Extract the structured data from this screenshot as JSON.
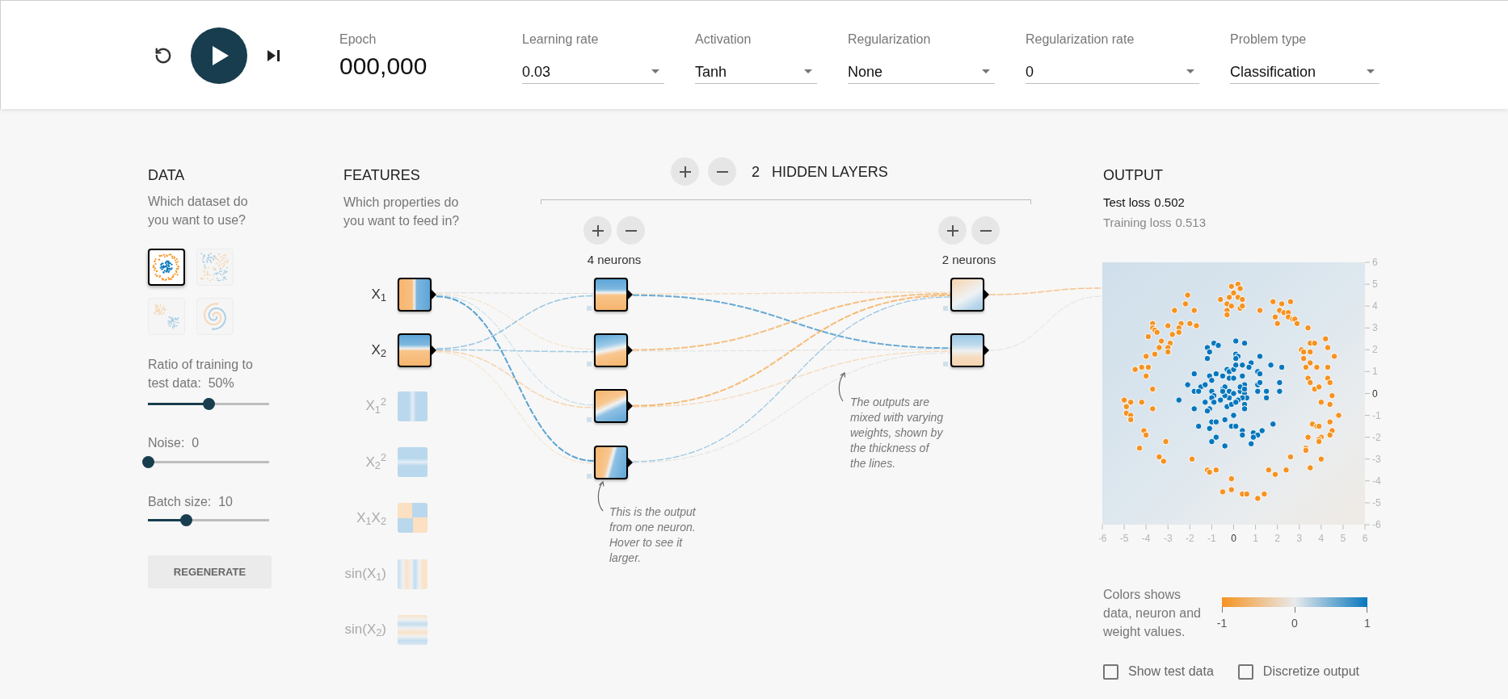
{
  "toolbar": {
    "playing": false,
    "epoch_label": "Epoch",
    "epoch": "000,000",
    "dropdowns": [
      {
        "label": "Learning rate",
        "value": "0.03"
      },
      {
        "label": "Activation",
        "value": "Tanh"
      },
      {
        "label": "Regularization",
        "value": "None"
      },
      {
        "label": "Regularization rate",
        "value": "0"
      },
      {
        "label": "Problem type",
        "value": "Classification"
      }
    ]
  },
  "data": {
    "title": "DATA",
    "prompt": "Which dataset do you want to use?",
    "datasets": [
      {
        "kind": "circle",
        "selected": true
      },
      {
        "kind": "xor",
        "selected": false
      },
      {
        "kind": "gauss",
        "selected": false
      },
      {
        "kind": "spiral",
        "selected": false
      }
    ],
    "sliders": [
      {
        "label": "Ratio of training to test data:",
        "reading": "50%",
        "level": 0.5
      },
      {
        "label": "Noise:",
        "reading": "0",
        "level": 0
      },
      {
        "label": "Batch size:",
        "reading": "10",
        "level": 0.31
      }
    ],
    "button": "REGENERATE"
  },
  "features": {
    "title": "FEATURES",
    "prompt": "Which properties do you want to feed in?",
    "items": [
      {
        "label": "X$_{1}$",
        "kind": "vertical",
        "selected": true
      },
      {
        "label": "X$_{2}$",
        "kind": "horizontal",
        "selected": true
      },
      {
        "label": "X$_{1}$$^{2}$",
        "kind": "vband",
        "selected": false
      },
      {
        "label": "X$_{2}$$^{2}$",
        "kind": "hband",
        "selected": false
      },
      {
        "label": "X$_{1}$X$_{2}$",
        "kind": "quadrants",
        "selected": false
      },
      {
        "label": "sin(X$_{1}$)",
        "kind": "vstripes",
        "selected": false
      },
      {
        "label": "sin(X$_{2}$)",
        "kind": "hstripes",
        "selected": false
      }
    ]
  },
  "network": {
    "layer_count": "2",
    "layers_label": "HIDDEN LAYERS",
    "layers": [
      {
        "neurons_label": "4 neurons",
        "nodes": [
          {
            "kind": "horizontal"
          },
          {
            "kind": "tilted"
          },
          {
            "kind": "diagonal"
          },
          {
            "kind": "slanted"
          }
        ]
      },
      {
        "neurons_label": "2 neurons",
        "nodes": [
          {
            "kind": "faded"
          },
          {
            "kind": "soft"
          }
        ]
      }
    ],
    "notes": [
      "This is the output from one neuron. Hover to see it larger.",
      "The outputs are mixed with varying weights, shown by the thickness of the lines."
    ]
  },
  "output": {
    "title": "OUTPUT",
    "test_loss": {
      "label": "Test loss",
      "value": "0.502"
    },
    "training_loss": {
      "label": "Training loss",
      "value": "0.513"
    },
    "chart_data": {
      "type": "scatter",
      "xlim": [
        -6,
        6
      ],
      "ylim": [
        -6,
        6
      ],
      "xticks": [
        -6,
        -5,
        -4,
        -3,
        -2,
        -1,
        0,
        1,
        2,
        3,
        4,
        5,
        6
      ],
      "yticks": [
        6,
        5,
        4,
        3,
        2,
        1,
        0,
        -1,
        -2,
        -3,
        -4,
        -5,
        -6
      ],
      "series": [
        {
          "color": "#f59322",
          "x": [
            -0.1,
            0.2,
            0.3,
            -0.6,
            -0.2,
            0.0,
            0.2,
            0.4,
            -0.3,
            -0.1,
            0.3,
            0.4,
            -0.3,
            -0.3,
            1.2,
            1.8,
            2.2,
            2.6,
            1.9,
            2.1,
            2.3,
            2.5,
            2.5,
            2.7,
            2.8,
            2.9,
            2.0,
            3.4,
            -2.1,
            -2.2,
            -2.7,
            -1.8,
            -2.4,
            -2.0,
            -1.7,
            -2.5,
            -2.5,
            -3.0,
            -2.8,
            -3.3,
            -2.9,
            -3.0,
            -3.0,
            -3.4,
            -3.7,
            -3.7,
            -3.6,
            -3.5,
            -3.9,
            -3.6,
            -4.0,
            -3.9,
            -4.2,
            -4.0,
            -4.5,
            -3.7,
            -5.0,
            -4.7,
            -4.9,
            -4.9,
            -4.7,
            -4.7,
            -4.2,
            -3.7,
            -4.1,
            -4.0,
            -4.3,
            -3.1,
            -3.4,
            -3.2,
            -1.9,
            -1.2,
            -1.1,
            -0.8,
            -0.1,
            -0.1,
            -0.5,
            0.4,
            0.6,
            1.1,
            1.4,
            1.6,
            1.9,
            2.4,
            2.6,
            3.5,
            4.0,
            3.5,
            3.7,
            4.2,
            4.3,
            4.6,
            3.1,
            3.2,
            3.5,
            3.2,
            3.5,
            3.3,
            3.8,
            4.3,
            3.4,
            3.5,
            3.7,
            3.9,
            4.3,
            4.4,
            4.5,
            4.0,
            4.4,
            4.8,
            3.6,
            3.8,
            3.9,
            4.4,
            4.5,
            4.4,
            4.0,
            3.9,
            3.9,
            3.4,
            3.3,
            3.3
          ],
          "values": [
            4.9,
            5.0,
            4.8,
            4.3,
            4.4,
            4.6,
            4.4,
            4.3,
            4.1,
            4.0,
            3.9,
            4.0,
            3.8,
            3.6,
            3.8,
            4.2,
            4.1,
            4.2,
            3.5,
            3.8,
            3.7,
            3.7,
            3.5,
            3.4,
            3.4,
            3.2,
            3.2,
            3.0,
            4.5,
            4.1,
            3.8,
            3.8,
            3.2,
            3.2,
            3.1,
            3.0,
            2.8,
            3.1,
            2.7,
            2.4,
            2.3,
            2.1,
            1.9,
            2.1,
            3.2,
            3.0,
            2.9,
            2.8,
            2.6,
            1.8,
            1.7,
            1.2,
            1.2,
            0.8,
            1.1,
            0.2,
            -0.3,
            -0.4,
            -0.6,
            -0.9,
            -1.0,
            -1.2,
            -0.4,
            -0.7,
            -1.7,
            -1.9,
            -2.5,
            -2.2,
            -2.9,
            -3.1,
            -3.0,
            -3.5,
            -3.6,
            -3.5,
            -3.9,
            -4.4,
            -4.5,
            -4.6,
            -4.6,
            -4.8,
            -4.6,
            -3.5,
            -3.7,
            -3.5,
            -2.9,
            -3.4,
            -3.0,
            2.3,
            2.3,
            2.5,
            2.1,
            1.7,
            2.0,
            1.9,
            1.9,
            1.6,
            1.4,
            1.2,
            1.2,
            1.2,
            0.7,
            0.5,
            0.2,
            0.3,
            0.7,
            0.5,
            -0.1,
            -0.4,
            -0.5,
            -1.0,
            -1.4,
            -1.5,
            -1.5,
            -1.3,
            -1.7,
            -1.9,
            -2.0,
            -2.1,
            -2.2,
            -2.0,
            -2.5,
            -2.6
          ]
        },
        {
          "color": "#0877bd",
          "x": [
            0.1,
            0.5,
            -0.9,
            -0.7,
            -1.2,
            -1.1,
            -1.2,
            0.1,
            0.2,
            0.1,
            1.2,
            0.8,
            0.4,
            0.7,
            1.7,
            2.2,
            -1.8,
            -1.1,
            -0.8,
            -0.5,
            -0.3,
            -0.2,
            0.0,
            -0.2,
            0.0,
            0.4,
            1.1,
            1.2,
            -1.0,
            -2.1,
            -1.5,
            -1.3,
            -1.8,
            -1.6,
            -1.0,
            -0.9,
            -1.0,
            -0.5,
            -0.4,
            -0.2,
            0.0,
            0.3,
            0.5,
            0.3,
            1.1,
            1.2,
            1.5,
            2.1,
            2.1,
            1.1,
            0.5,
            0.6,
            0.4,
            0.2,
            -0.2,
            -0.4,
            -0.6,
            -0.9,
            -1.3,
            -2.5,
            -1.8,
            -1.1,
            -1.2,
            -0.3,
            -0.1,
            0.1,
            0.5,
            0.5,
            0.0,
            -0.4,
            -1.0,
            -0.8,
            -1.6,
            -1.1,
            -0.1,
            0.1,
            0.4,
            0.4,
            0.9,
            1.1,
            1.3,
            1.8,
            0.9,
            0.8,
            -0.8,
            -1.0,
            -0.4,
            1.5,
            0.1,
            -0.5,
            0.5
          ],
          "values": [
            2.4,
            2.3,
            2.3,
            2.2,
            2.1,
            1.9,
            1.6,
            1.8,
            1.7,
            1.6,
            1.7,
            1.4,
            1.3,
            1.2,
            1.3,
            1.2,
            0.9,
            0.8,
            0.9,
            0.8,
            1.1,
            1.0,
            1.1,
            0.7,
            0.7,
            0.8,
            1.0,
            0.9,
            0.6,
            0.4,
            0.3,
            0.4,
            0.1,
            0.1,
            0.1,
            -0.1,
            -0.2,
            0.2,
            0.3,
            0.1,
            0.0,
            0.1,
            0.4,
            0.3,
            0.4,
            0.5,
            0.1,
            0.5,
            0.1,
            0.1,
            0.0,
            -0.2,
            -0.2,
            -0.3,
            -0.2,
            -0.1,
            -0.3,
            -0.4,
            -0.4,
            -0.3,
            -0.7,
            -0.7,
            -0.8,
            -0.6,
            -0.5,
            -0.4,
            -0.5,
            -0.7,
            -1.0,
            -1.2,
            -1.3,
            -1.3,
            -1.5,
            -1.6,
            -1.5,
            -1.5,
            -1.7,
            -1.9,
            -1.8,
            -1.9,
            -1.7,
            -1.4,
            -2.0,
            -2.3,
            -2.0,
            -2.2,
            -2.4,
            -0.2,
            1.3,
            0.1,
            0.2
          ]
        }
      ]
    },
    "legend": {
      "text": "Colors shows data, neuron and weight values.",
      "ticks": [
        "-1",
        "0",
        "1"
      ]
    },
    "checkboxes": [
      {
        "label": "Show test data",
        "checked": false
      },
      {
        "label": "Discretize output",
        "checked": false
      }
    ]
  }
}
